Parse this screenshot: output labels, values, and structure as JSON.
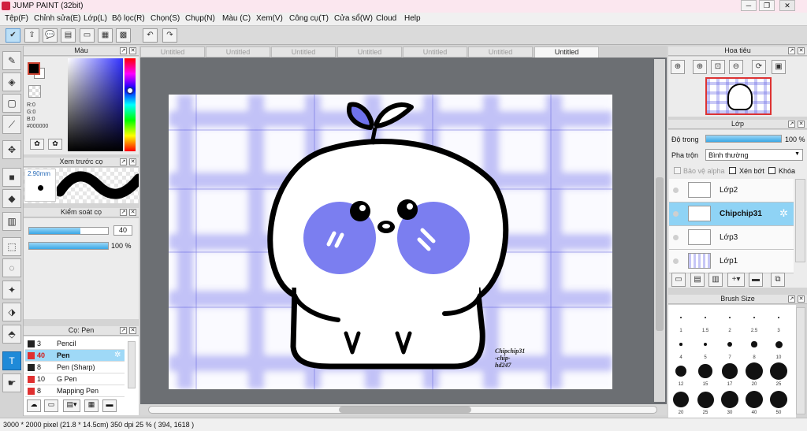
{
  "app": {
    "title": "JUMP PAINT (32bit)"
  },
  "window_controls": {
    "minimize": "─",
    "restore": "❐",
    "close": "✕"
  },
  "menu": [
    "Tệp(F)",
    "Chỉnh sửa(E)",
    "Lớp(L)",
    "Bộ lọc(R)",
    "Chọn(S)",
    "Chụp(N)",
    "Màu (C)",
    "Xem(V)",
    "Công cụ(T)",
    "Cửa sổ(W)",
    "Cloud",
    "Help"
  ],
  "tabs": [
    "Untitled",
    "Untitled",
    "Untitled",
    "Untitled",
    "Untitled",
    "Untitled",
    "Untitled"
  ],
  "active_tab_index": 6,
  "color_panel": {
    "title": "Màu",
    "r": "R:0",
    "g": "G:0",
    "b": "B:0",
    "hex": "#000000",
    "foreground": "#000000",
    "background": "#ffffff"
  },
  "preview_panel": {
    "title": "Xem trước cọ",
    "size": "2.90mm"
  },
  "brush_control": {
    "title": "Kiểm soát cọ",
    "size_value": "40",
    "opacity_value": "100 %",
    "size_level": 0.65,
    "opacity_level": 1.0
  },
  "brush_list": {
    "title": "Cọ: Pen",
    "items": [
      {
        "num": "3",
        "name": "Pencil",
        "color": "#222222"
      },
      {
        "num": "40",
        "name": "Pen",
        "color": "#e03030"
      },
      {
        "num": "8",
        "name": "Pen (Sharp)",
        "color": "#222222"
      },
      {
        "num": "10",
        "name": "G Pen",
        "color": "#e03030"
      },
      {
        "num": "8",
        "name": "Mapping Pen",
        "color": "#e03030"
      }
    ],
    "selected_index": 1
  },
  "navigator": {
    "title": "Hoa tiêu"
  },
  "layers": {
    "title": "Lớp",
    "opacity_label": "Độ trong",
    "opacity_value": "100 %",
    "blend_label": "Pha trộn",
    "blend_value": "Bình thường",
    "protect_alpha": "Bảo vệ alpha",
    "clipping": "Xén bớt",
    "lock": "Khóa",
    "items": [
      {
        "name": "Lớp2"
      },
      {
        "name": "Chipchip31"
      },
      {
        "name": "Lớp3"
      },
      {
        "name": "Lớp1"
      }
    ],
    "selected_index": 1
  },
  "brush_size": {
    "title": "Brush Size",
    "rows": [
      [
        "1",
        "1.5",
        "2",
        "2.5",
        "3"
      ],
      [
        "4",
        "5",
        "7",
        "8",
        "10"
      ],
      [
        "12",
        "15",
        "17",
        "20",
        "25"
      ],
      [
        "20",
        "25",
        "30",
        "40",
        "50"
      ]
    ]
  },
  "artwork": {
    "signature": "Chipchip31\n-chip-\nhd247"
  },
  "status": {
    "dimensions": "3000 * 2000 pixel  (21.8 * 14.5cm)  350 dpi  25 %  ( 394, 1618 )"
  },
  "colors": {
    "accent": "#1f8ad8",
    "selection": "#8fd3f5",
    "grid": "#5a5ae6",
    "blush": "#7b7ef0"
  }
}
